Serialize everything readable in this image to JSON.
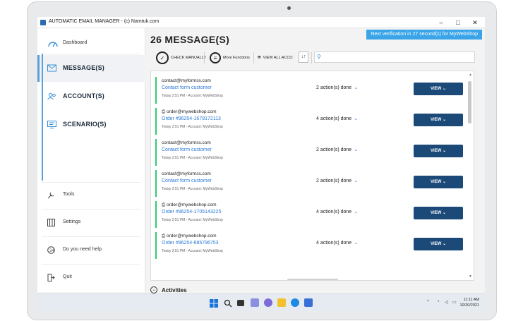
{
  "window": {
    "title": "AUTOMATIC EMAIL MANAGER - (c) Namtuk.com",
    "minimize": "–",
    "maximize": "□",
    "close": "✕"
  },
  "sidebar": {
    "dashboard": "Dashboard",
    "items": [
      {
        "label": "MESSAGE(S)",
        "icon": "mail-icon",
        "active": true
      },
      {
        "label": "ACCOUNT(S)",
        "icon": "people-icon",
        "active": false
      },
      {
        "label": "SCENARIO(S)",
        "icon": "scenario-icon",
        "active": false
      }
    ],
    "bottom": [
      {
        "label": "Tools",
        "icon": "tools-icon"
      },
      {
        "label": "Settings",
        "icon": "settings-icon"
      },
      {
        "label": "Do you need help",
        "icon": "help-icon"
      },
      {
        "label": "Quit",
        "icon": "quit-icon"
      }
    ]
  },
  "main": {
    "banner": "Next verification in 27 second(s) for MyWebShop",
    "title": "26 MESSAGE(S)",
    "toolbar": {
      "check_manually": "CHECK MANUALLY",
      "more_functions": "More Functions",
      "view_all_accounts": "VIEW ALL ACCO"
    },
    "activities": "Activities"
  },
  "messages": [
    {
      "sender": "contact@myformss.com",
      "attach": false,
      "subject": "Contact form customer",
      "meta": "Today 2:51 PM - Account: MyWebShop",
      "actions": "2 action(s) done",
      "view": "VIEW"
    },
    {
      "sender": "order@mywebshop.com",
      "attach": true,
      "subject": "Order #96254-1678172113",
      "meta": "Today 2:51 PM - Account: MyWebShop",
      "actions": "4 action(s) done",
      "view": "VIEW"
    },
    {
      "sender": "contact@myformss.com",
      "attach": false,
      "subject": "Contact form customer",
      "meta": "Today 2:51 PM - Account: MyWebShop",
      "actions": "2 action(s) done",
      "view": "VIEW"
    },
    {
      "sender": "contact@myformss.com",
      "attach": false,
      "subject": "Contact form customer",
      "meta": "Today 2:51 PM - Account: MyWebShop",
      "actions": "2 action(s) done",
      "view": "VIEW"
    },
    {
      "sender": "order@mywebshop.com",
      "attach": true,
      "subject": "Order #96254-1705143225",
      "meta": "Today 2:51 PM - Account: MyWebShop",
      "actions": "4 action(s) done",
      "view": "VIEW"
    },
    {
      "sender": "order@mywebshop.com",
      "attach": true,
      "subject": "Order #96254-685796753",
      "meta": "Today 2:51 PM - Account: MyWebShop",
      "actions": "4 action(s) done",
      "view": "VIEW"
    }
  ],
  "taskbar": {
    "time": "11:11 AM",
    "date": "10/20/2021"
  },
  "colors": {
    "accent": "#1c4a78",
    "banner": "#3aa4e8",
    "link": "#2a7ad6",
    "status_bar": "#2ecc71"
  }
}
